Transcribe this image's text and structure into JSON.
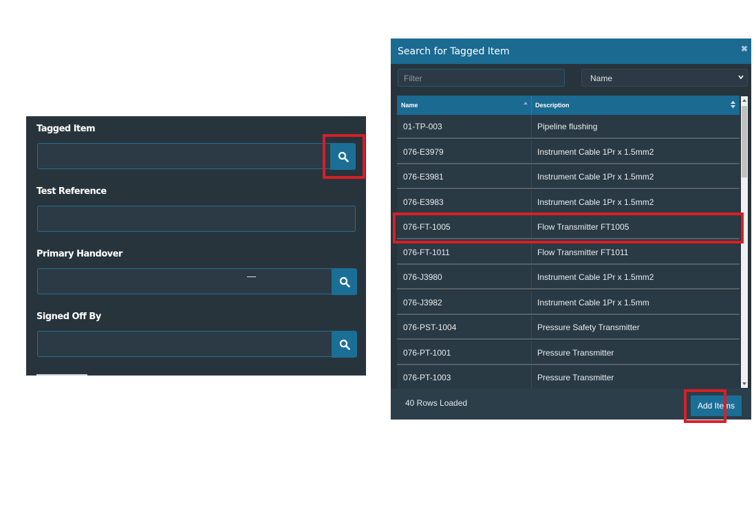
{
  "form": {
    "fields": [
      {
        "label": "Tagged Item",
        "value": ""
      },
      {
        "label": "Test Reference",
        "value": ""
      },
      {
        "label": "Primary Handover",
        "value": ""
      },
      {
        "label": "Signed Off By",
        "value": ""
      }
    ],
    "search_icon": "search-icon"
  },
  "modal": {
    "title": "Search for Tagged Item",
    "close_icon": "close-icon",
    "filter_placeholder": "Filter",
    "column_select_value": "Name",
    "columns": [
      "Name",
      "Description"
    ],
    "rows": [
      {
        "name": "01-TP-003",
        "description": "Pipeline flushing"
      },
      {
        "name": "076-E3979",
        "description": "Instrument Cable 1Pr x 1.5mm2"
      },
      {
        "name": "076-E3981",
        "description": "Instrument Cable 1Pr x 1.5mm2"
      },
      {
        "name": "076-E3983",
        "description": "Instrument Cable 1Pr x 1.5mm2"
      },
      {
        "name": "076-FT-1005",
        "description": "Flow Transmitter FT1005"
      },
      {
        "name": "076-FT-1011",
        "description": "Flow Transmitter FT1011"
      },
      {
        "name": "076-J3980",
        "description": "Instrument Cable 1Pr x 1.5mm2"
      },
      {
        "name": "076-J3982",
        "description": "Instrument Cable 1Pr x 1.5mm"
      },
      {
        "name": "076-PST-1004",
        "description": "Pressure Safety Transmitter"
      },
      {
        "name": "076-PT-1001",
        "description": "Pressure Transmitter"
      },
      {
        "name": "076-PT-1003",
        "description": "Pressure Transmitter"
      }
    ],
    "rows_loaded": "40 Rows Loaded",
    "add_button": "Add Items"
  },
  "colors": {
    "panel_bg": "#28343c",
    "accent": "#1a6a91",
    "highlight": "#d71f27"
  }
}
